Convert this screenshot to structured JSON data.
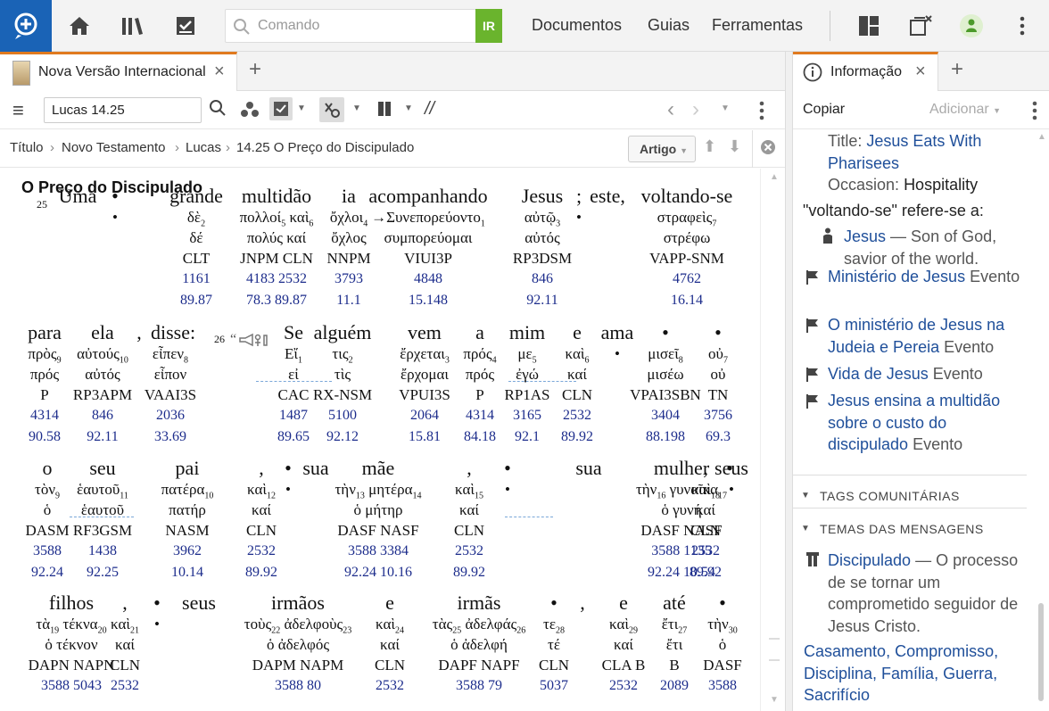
{
  "topbar": {
    "search_placeholder": "Comando",
    "go_label": "IR",
    "menu": [
      "Documentos",
      "Guias",
      "Ferramentas"
    ]
  },
  "left_panel": {
    "tab_title": "Nova Versão Internacional",
    "reference": "Lucas 14.25",
    "breadcrumb": [
      "Título",
      "Novo Testamento",
      "Lucas",
      "14.25 O Preço do Discipulado"
    ],
    "artigo_label": "Artigo",
    "heading": "O Preço do Discipulado",
    "lines": [
      {
        "words": [
          {
            "en": "Uma"
          },
          {
            "en": "•",
            "gk": "•"
          },
          {
            "en": "grande",
            "gk": "δὲ",
            "gs": "2",
            "lm": "δέ",
            "mo": "CLT",
            "sn": "1161",
            "ff": "89.87"
          },
          {
            "en": "multidão",
            "gk": "πολλοί",
            "gs": "5",
            "gk2": " καὶ",
            "gs2": "6",
            "lm": "πολύς καί",
            "mo": "JNPM CLN",
            "sn": "4183 2532",
            "ff": "78.3 89.87"
          },
          {
            "en": "ia",
            "gk": "ὄχλοι",
            "gs": "4",
            "lm": "ὄχλος",
            "mo": "NNPM",
            "sn": "3793",
            "ff": "11.1"
          },
          {
            "en": "acompanhando",
            "gk": "→",
            "gk2": "Συνεπορεύοντο",
            "gs2": "1",
            "lm": "συμπορεύομαι",
            "mo": "VIUI3P",
            "sn": "4848",
            "ff": "15.148"
          },
          {
            "en": "Jesus",
            "gk": "αὐτῷ",
            "gs": "3",
            "lm": "αὐτός",
            "mo": "RP3DSM",
            "sn": "846",
            "ff": "92.11"
          },
          {
            "en": ";",
            "gk": "•"
          },
          {
            "en": "este,",
            "gk": ""
          },
          {
            "en": "voltando-se",
            "gk": "στραφεὶς",
            "gs": "7",
            "lm": "στρέφω",
            "mo": "VAPP-SNM",
            "sn": "4762",
            "ff": "16.14"
          }
        ]
      },
      {
        "words": [
          {
            "en": "para",
            "gk": "πρὸς",
            "gs": "9",
            "lm": "πρός",
            "mo": "P",
            "sn": "4314",
            "ff": "90.58"
          },
          {
            "en": "ela",
            "gk": "αὐτούς",
            "gs": "10",
            "lm": "αὐτός",
            "mo": "RP3APM",
            "sn": "846",
            "ff": "92.11"
          },
          {
            "en": ",",
            "gk": ""
          },
          {
            "en": "disse",
            "gk": "εἶπεν",
            "gs": "8",
            "lm": "εἶπον",
            "mo": "VAAI3S",
            "sn": "2036",
            "ff": "33.69"
          },
          {
            "en": ":",
            "gk": ""
          },
          {
            "en": "Se",
            "gk": "Εἴ",
            "gs": "1",
            "lm": "εἰ",
            "mo": "CAC",
            "sn": "1487",
            "ff": "89.65"
          },
          {
            "en": "alguém",
            "gk": "τις",
            "gs": "2",
            "lm": "τὶς",
            "mo": "RX-NSM",
            "sn": "5100",
            "ff": "92.12"
          },
          {
            "en": "vem",
            "gk": "ἔρχεται",
            "gs": "3",
            "lm": "ἔρχομαι",
            "mo": "VPUI3S",
            "sn": "2064",
            "ff": "15.81"
          },
          {
            "en": "a",
            "gk": "πρός",
            "gs": "4",
            "lm": "πρός",
            "mo": "P",
            "sn": "4314",
            "ff": "84.18"
          },
          {
            "en": "mim",
            "gk": "με",
            "gs": "5",
            "lm": "ἐγώ",
            "mo": "RP1AS",
            "sn": "3165",
            "ff": "92.1"
          },
          {
            "en": "e",
            "gk": "καὶ",
            "gs": "6",
            "lm": "καί",
            "mo": "CLN",
            "sn": "2532",
            "ff": "89.92"
          },
          {
            "en": "ama",
            "gk": "•"
          },
          {
            "en": "•",
            "gk": "μισεῖ",
            "gs": "8",
            "lm": "μισέω",
            "mo": "VPAI3SBN",
            "sn": "3404",
            "ff": "88.198"
          },
          {
            "en": "•",
            "gk": "οὐ",
            "gs": "7",
            "lm": "οὐ",
            "mo": "TN",
            "sn": "3756",
            "ff": "69.3"
          }
        ]
      },
      {
        "words": [
          {
            "en": "o",
            "gk": "τὸν",
            "gs": "9",
            "lm": "ὁ",
            "mo": "DASM",
            "sn": "3588",
            "ff": "92.24"
          },
          {
            "en": "seu",
            "gk": "ἑαυτοῦ",
            "gs": "11",
            "lm": "ἑαυτοῦ",
            "mo": "RF3GSM",
            "sn": "1438",
            "ff": "92.25"
          },
          {
            "en": "pai",
            "gk": "πατέρα",
            "gs": "10",
            "lm": "πατήρ",
            "mo": "NASM",
            "sn": "3962",
            "ff": "10.14"
          },
          {
            "en": ",",
            "gk": "καὶ",
            "gs": "12",
            "lm": "καί",
            "mo": "CLN",
            "sn": "2532",
            "ff": "89.92"
          },
          {
            "en": "•",
            "gk": "•"
          },
          {
            "en": "sua",
            "gk": ""
          },
          {
            "en": "mãe",
            "gk": "τὴν",
            "gs": "13",
            "gk2": " μητέρα",
            "gs2": "14",
            "lm": "ὁ μήτηρ",
            "mo": "DASF NASF",
            "sn": "3588 3384",
            "ff": "92.24 10.16"
          },
          {
            "en": ",",
            "gk": "καὶ",
            "gs": "15",
            "lm": "καί",
            "mo": "CLN",
            "sn": "2532",
            "ff": "89.92"
          },
          {
            "en": "•",
            "gk": "•"
          },
          {
            "en": "sua",
            "gk": ""
          },
          {
            "en": "mulher",
            "gk": "τὴν",
            "gs": "16",
            "gk2": " γυναῖκα",
            "gs2": "17",
            "lm": "ὁ γυνή",
            "mo": "DASF NASF",
            "sn": "3588 1135",
            "ff": "92.24 10.54"
          },
          {
            "en": ",",
            "gk": "καὶ",
            "gs": "18",
            "lm": "καί",
            "mo": "CLN",
            "sn": "2532",
            "ff": "89.92"
          },
          {
            "en": "•",
            "gk": ""
          },
          {
            "en": "seus",
            "gk": "•"
          }
        ]
      },
      {
        "words": [
          {
            "en": "filhos",
            "gk": "τὰ",
            "gs": "19",
            "gk2": " τέκνα",
            "gs2": "20",
            "lm": "ὁ τέκνον",
            "mo": "DAPN NAPN",
            "sn": "3588 5043"
          },
          {
            "en": ",",
            "gk": "καὶ",
            "gs": "21",
            "lm": "καί",
            "mo": "CLN",
            "sn": "2532"
          },
          {
            "en": "•",
            "gk": "•"
          },
          {
            "en": "seus",
            "gk": ""
          },
          {
            "en": "irmãos",
            "gk": "τοὺς",
            "gs": "22",
            "gk2": " ἀδελφοὺς",
            "gs2": "23",
            "lm": "ὁ ἀδελφός",
            "mo": "DAPM NAPM",
            "sn": "3588 80"
          },
          {
            "en": "e",
            "gk": "καὶ",
            "gs": "24",
            "lm": "καί",
            "mo": "CLN",
            "sn": "2532"
          },
          {
            "en": "irmãs",
            "gk": "τὰς",
            "gs": "25",
            "gk2": " ἀδελφάς",
            "gs2": "26",
            "lm": "ὁ ἀδελφή",
            "mo": "DAPF NAPF",
            "sn": "3588 79"
          },
          {
            "en": "•",
            "gk": "τε",
            "gs": "28",
            "lm": "τέ",
            "mo": "CLN",
            "sn": "5037"
          },
          {
            "en": ",",
            "gk": ""
          },
          {
            "en": "e",
            "gk": "καὶ",
            "gs": "29",
            "lm": "καί",
            "mo": "CLA B",
            "sn": "2532"
          },
          {
            "en": "até",
            "gk": "ἔτι",
            "gs": "27",
            "lm": "ἔτι",
            "mo": "B",
            "sn": "2089"
          },
          {
            "en": "•",
            "gk": "τὴν",
            "gs": "30",
            "lm": "ὁ",
            "mo": "DASF",
            "sn": "3588"
          }
        ]
      }
    ],
    "verse_numbers": [
      "25",
      "26"
    ]
  },
  "right_panel": {
    "tab_title": "Informação",
    "copy_label": "Copiar",
    "add_label": "Adicionar",
    "title_label": "Title:",
    "title_value": "Jesus Eats With Pharisees",
    "occasion_label": "Occasion:",
    "occasion_value": "Hospitality",
    "refers_text": "\"voltando-se\" refere-se a:",
    "person_name": "Jesus",
    "person_desc": "— Son of God, savior of the world.",
    "events": [
      {
        "name": "Ministério de Jesus",
        "type": "Evento"
      },
      {
        "name": "O ministério de Jesus na Judeia e Pereia",
        "type": "Evento"
      },
      {
        "name": "Vida de Jesus",
        "type": "Evento"
      },
      {
        "name": "Jesus ensina a multidão sobre o custo do discipulado",
        "type": "Evento"
      }
    ],
    "section_tags": "TAGS COMUNITÁRIAS",
    "section_themes": "TEMAS DAS MENSAGENS",
    "theme_name": "Discipulado",
    "theme_desc": "— O processo de se tornar um comprometido seguidor de Jesus Cristo.",
    "theme_links": [
      "Casamento",
      "Compromisso",
      "Disciplina",
      "Família",
      "Guerra",
      "Sacrifício"
    ]
  },
  "colors": {
    "accent_orange": "#e07a1f",
    "logo_blue": "#1a63b6",
    "go_green": "#6ab42d",
    "link_blue": "#1f4f9a",
    "number_blue": "#1d2d8c"
  }
}
